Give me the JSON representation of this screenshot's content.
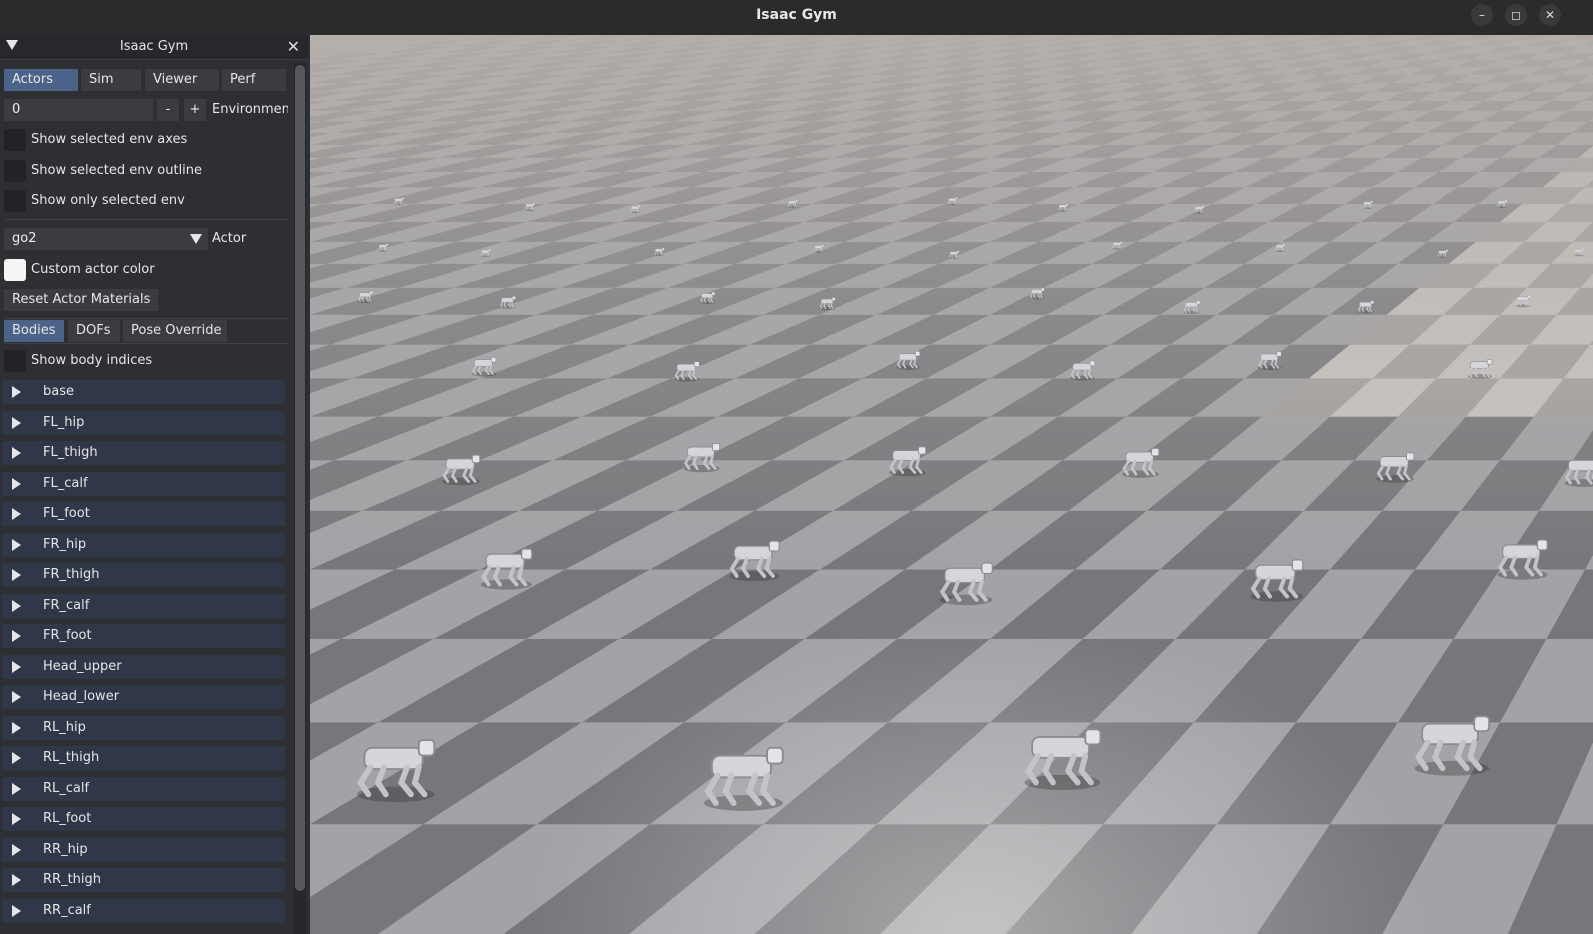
{
  "window": {
    "title": "Isaac Gym",
    "controls": [
      "minimize-icon",
      "maximize-icon",
      "close-icon"
    ]
  },
  "panel": {
    "title": "Isaac Gym",
    "tabs": [
      "Actors",
      "Sim",
      "Viewer",
      "Perf"
    ],
    "active_tab": "Actors",
    "environment": {
      "value": "0",
      "minus": "-",
      "plus": "+",
      "label": "Environment"
    },
    "checkboxes": [
      {
        "label": "Show selected env axes",
        "checked": false
      },
      {
        "label": "Show selected env outline",
        "checked": false
      },
      {
        "label": "Show only selected env",
        "checked": false
      }
    ],
    "actor": {
      "selected": "go2",
      "label": "Actor"
    },
    "custom_color_label": "Custom actor color",
    "reset_button": "Reset Actor Materials",
    "subtabs": [
      "Bodies",
      "DOFs",
      "Pose Override"
    ],
    "active_subtab": "Bodies",
    "show_indices_label": "Show body indices",
    "bodies": [
      "base",
      "FL_hip",
      "FL_thigh",
      "FL_calf",
      "FL_foot",
      "FR_hip",
      "FR_thigh",
      "FR_calf",
      "FR_foot",
      "Head_upper",
      "Head_lower",
      "RL_hip",
      "RL_thigh",
      "RL_calf",
      "RL_foot",
      "RR_hip",
      "RR_thigh",
      "RR_calf"
    ]
  },
  "colors": {
    "accent": "#4c6389",
    "panel_bg": "#2d2f33",
    "tree_row": "#2f3748",
    "floor_dark": "#7a7a7e",
    "floor_light": "#a6a6aa"
  }
}
